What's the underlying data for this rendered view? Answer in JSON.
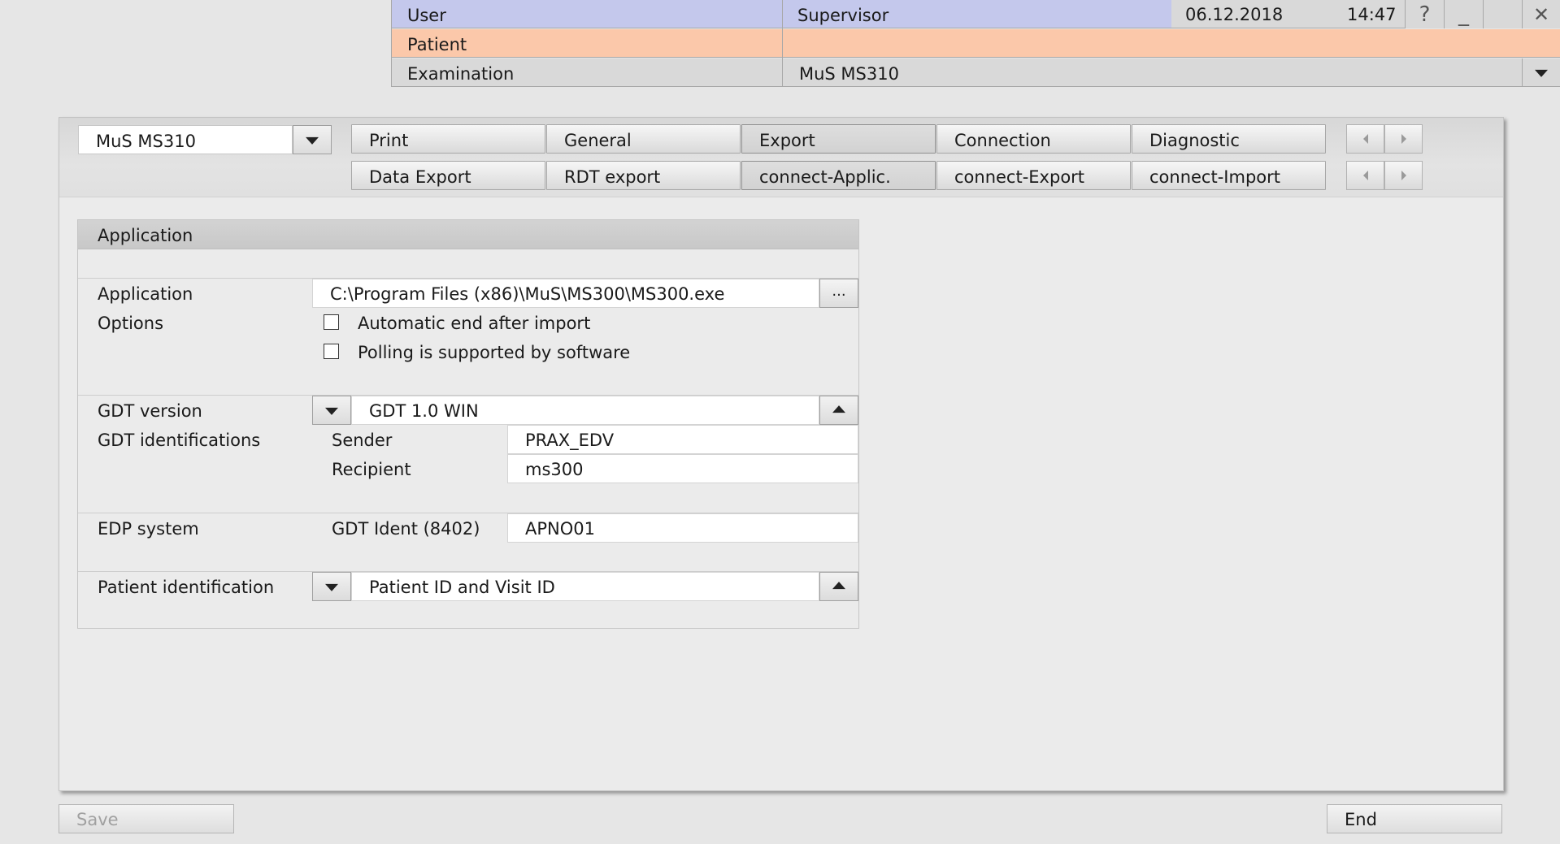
{
  "header": {
    "user_label": "User",
    "user_value": "Supervisor",
    "date": "06.12.2018",
    "time": "14:47",
    "patient_label": "Patient",
    "patient_value": "",
    "exam_label": "Examination",
    "exam_value": "MuS MS310",
    "help_glyph": "?",
    "minimize_glyph": "_",
    "close_glyph": "✕"
  },
  "device_select": {
    "value": "MuS MS310"
  },
  "tabs_row1": [
    {
      "label": "Print"
    },
    {
      "label": "General"
    },
    {
      "label": "Export",
      "active": true
    },
    {
      "label": "Connection"
    },
    {
      "label": "Diagnostic"
    }
  ],
  "tabs_row2": [
    {
      "label": "Data Export"
    },
    {
      "label": "RDT export"
    },
    {
      "label": "connect-Applic.",
      "active": true
    },
    {
      "label": "connect-Export"
    },
    {
      "label": "connect-Import"
    }
  ],
  "form": {
    "section_title": "Application",
    "application_label": "Application",
    "application_path": "C:\\Program Files (x86)\\MuS\\MS300\\MS300.exe",
    "browse_label": "...",
    "options_label": "Options",
    "option_auto_end": "Automatic end after import",
    "option_polling": "Polling is supported by software",
    "gdt_version_label": "GDT version",
    "gdt_version_value": "GDT 1.0 WIN",
    "gdt_ident_label": "GDT identifications",
    "sender_label": "Sender",
    "sender_value": "PRAX_EDV",
    "recipient_label": "Recipient",
    "recipient_value": "ms300",
    "edp_label": "EDP system",
    "gdt_ident_8402_label": "GDT Ident (8402)",
    "gdt_ident_8402_value": "APNO01",
    "patient_ident_label": "Patient identification",
    "patient_ident_value": "Patient ID and Visit ID"
  },
  "buttons": {
    "save": "Save",
    "end": "End"
  },
  "colors": {
    "user_row": "#c4c8ec",
    "patient_row": "#fbc8aa",
    "exam_row": "#d9d9d9",
    "disabled_text": "#a0a0a0"
  }
}
